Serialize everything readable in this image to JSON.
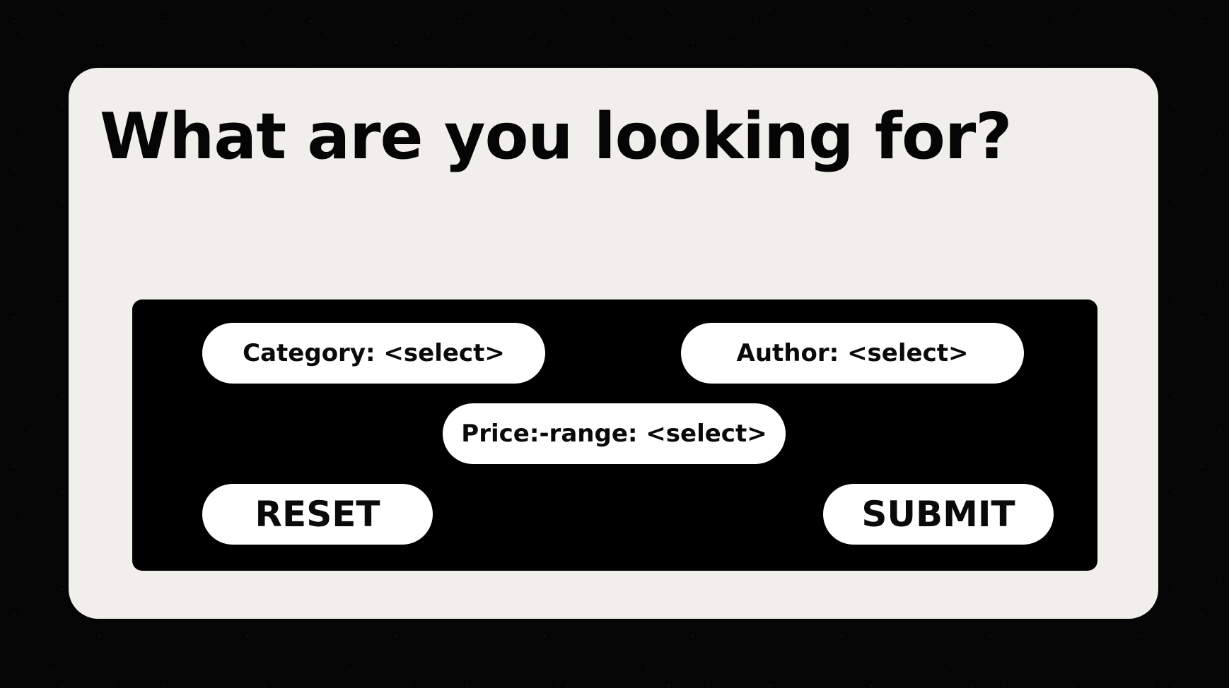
{
  "page": {
    "title": "What are you looking for?"
  },
  "filters": {
    "category_label": "Category: <select>",
    "author_label": "Author: <select>",
    "price_label": "Price:-range: <select>"
  },
  "actions": {
    "reset_label": "RESET",
    "submit_label": "SUBMIT"
  },
  "colors": {
    "background": "#050505",
    "card": "#f0efeb",
    "panel": "#000000",
    "pill": "#ffffff",
    "text": "#0a0a0a"
  }
}
